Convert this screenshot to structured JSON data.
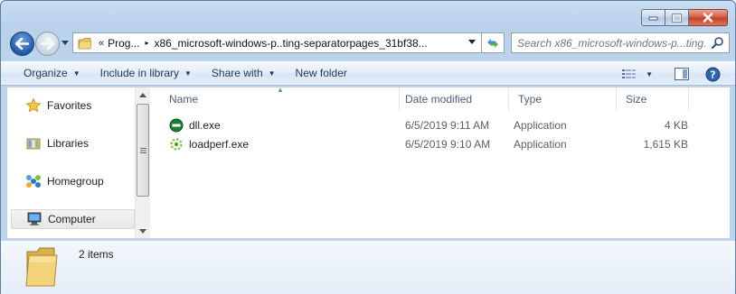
{
  "window": {
    "caption_buttons": [
      {
        "name": "minimize",
        "icon": "minimize-icon"
      },
      {
        "name": "maximize",
        "icon": "maximize-icon"
      },
      {
        "name": "close",
        "icon": "close-icon"
      }
    ]
  },
  "address_bar": {
    "overflow_glyph": "«",
    "crumbs": [
      "Prog...",
      "x86_microsoft-windows-p..ting-separatorpages_31bf38..."
    ],
    "separator_glyph": "▸"
  },
  "search": {
    "placeholder": "Search x86_microsoft-windows-p...ting..."
  },
  "command_bar": {
    "organize": "Organize",
    "include_in_library": "Include in library",
    "share_with": "Share with",
    "new_folder": "New folder",
    "dropdown_glyph": "▼"
  },
  "nav_pane": {
    "items": [
      {
        "label": "Favorites",
        "icon": "star-icon"
      },
      {
        "label": "Libraries",
        "icon": "library-icon"
      },
      {
        "label": "Homegroup",
        "icon": "homegroup-icon"
      },
      {
        "label": "Computer",
        "icon": "computer-icon",
        "selected": true
      }
    ]
  },
  "file_list": {
    "columns": [
      "Name",
      "Date modified",
      "Type",
      "Size"
    ],
    "sort_column": "Name",
    "rows": [
      {
        "name": "dll.exe",
        "date": "6/5/2019 9:11 AM",
        "type": "Application",
        "size": "4 KB",
        "icon": "no-entry-app-icon"
      },
      {
        "name": "loadperf.exe",
        "date": "6/5/2019 9:10 AM",
        "type": "Application",
        "size": "1,615 KB",
        "icon": "gear-app-icon"
      }
    ]
  },
  "details_pane": {
    "item_count": "2 items",
    "icon": "folder-icon"
  },
  "colors": {
    "frame": "#bcd3ec",
    "command_text": "#1e395b",
    "header_text": "#4c607a",
    "cell_text": "#5e5e5e",
    "selected_nav": "#e6e6e6"
  }
}
